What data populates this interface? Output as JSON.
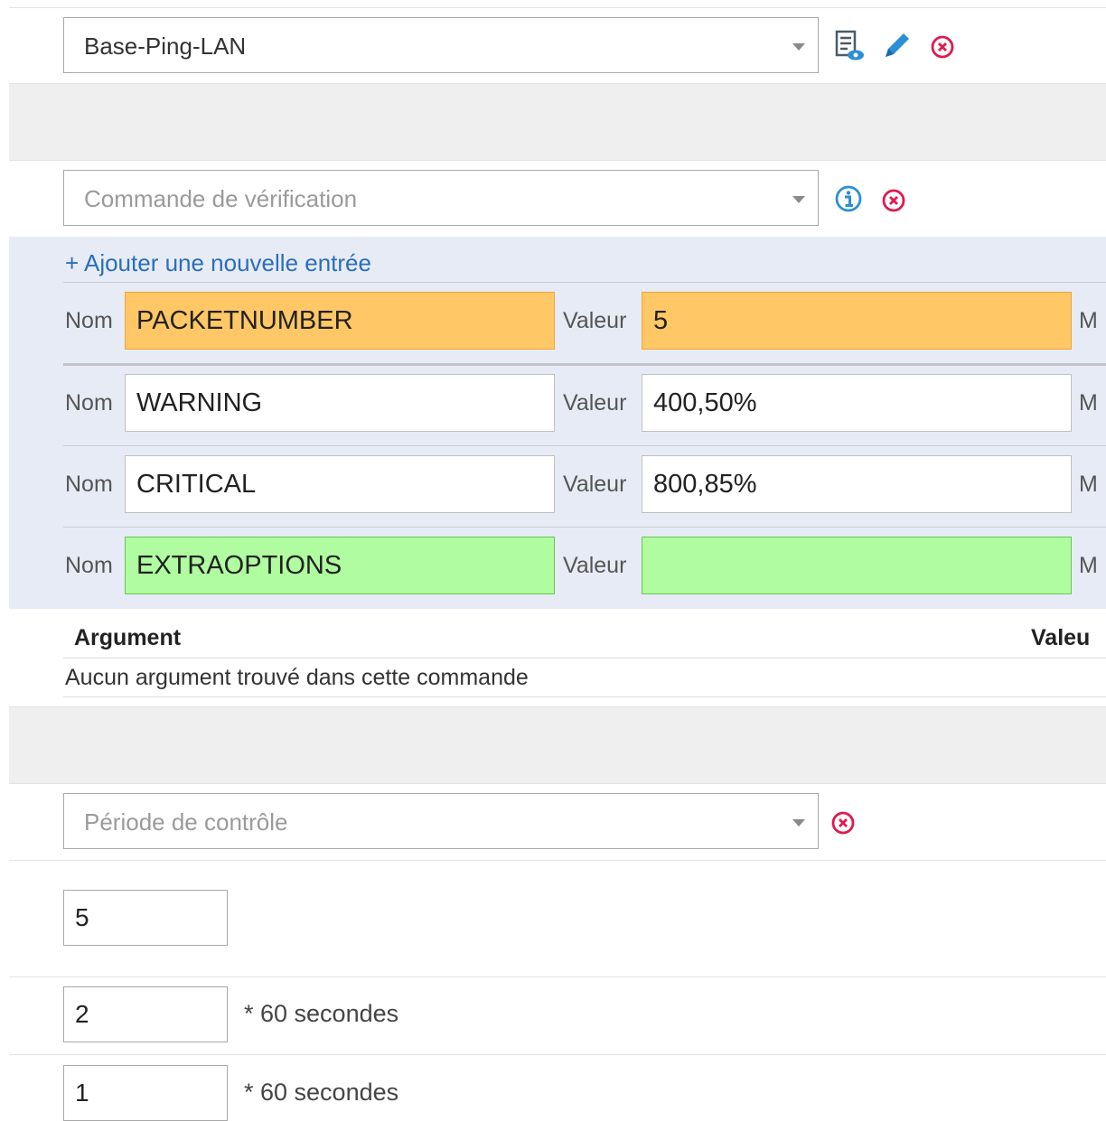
{
  "template": {
    "selected": "Base-Ping-LAN"
  },
  "check_command": {
    "placeholder": "Commande de vérification"
  },
  "macros": {
    "add_label": "+ Ajouter une nouvelle entrée",
    "name_label": "Nom",
    "value_label": "Valeur",
    "trailing_label": "M",
    "rows": [
      {
        "name": "PACKETNUMBER",
        "value": "5"
      },
      {
        "name": "WARNING",
        "value": "400,50%"
      },
      {
        "name": "CRITICAL",
        "value": "800,85%"
      },
      {
        "name": "EXTRAOPTIONS",
        "value": ""
      }
    ]
  },
  "arguments": {
    "col_argument": "Argument",
    "col_value": "Valeu",
    "empty_text": "Aucun argument trouvé dans cette commande"
  },
  "check_period": {
    "placeholder": "Période de contrôle"
  },
  "max_attempts": {
    "value": "5"
  },
  "normal_interval": {
    "value": "2",
    "suffix": "* 60 secondes"
  },
  "retry_interval": {
    "value": "1",
    "suffix": "* 60 secondes"
  },
  "colors": {
    "accent": "#2a6ebb",
    "danger": "#e0194e",
    "warn_row": "#ffc766",
    "ok_row": "#b0fca0"
  }
}
